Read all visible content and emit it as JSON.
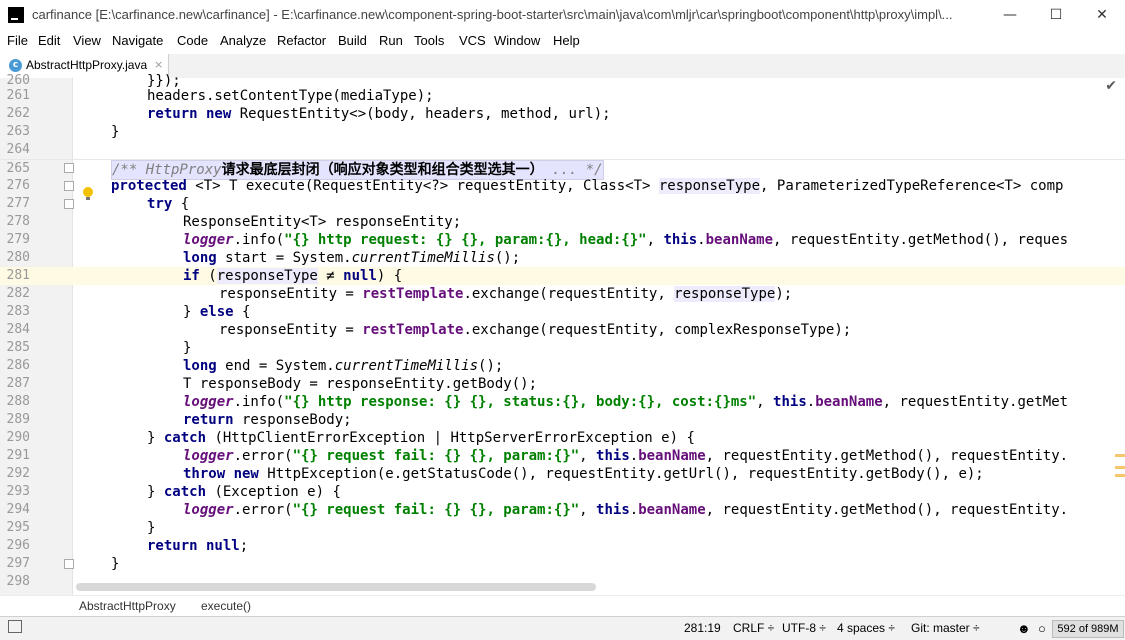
{
  "window": {
    "title": "carfinance [E:\\carfinance.new\\carfinance] - E:\\carfinance.new\\component-spring-boot-starter\\src\\main\\java\\com\\mljr\\car\\springboot\\component\\http\\proxy\\impl\\...",
    "minimize": "—",
    "maximize": "☐",
    "close": "✕"
  },
  "menu": [
    "File",
    "Edit",
    "View",
    "Navigate",
    "Code",
    "Analyze",
    "Refactor",
    "Build",
    "Run",
    "Tools",
    "VCS",
    "Window",
    "Help"
  ],
  "tab": {
    "icon": "c",
    "label": "AbstractHttpProxy.java",
    "close": "×"
  },
  "lines": [
    "260",
    "261",
    "262",
    "263",
    "264",
    "265",
    "276",
    "277",
    "278",
    "279",
    "280",
    "281",
    "282",
    "283",
    "284",
    "285",
    "286",
    "287",
    "288",
    "289",
    "290",
    "291",
    "292",
    "293",
    "294",
    "295",
    "296",
    "297",
    "298"
  ],
  "code": {
    "l260": "}});",
    "l261a": "headers.setContentType(mediaType);",
    "l262a": "return new",
    "l262b": " RequestEntity<>(body, headers, method, url);",
    "l263": "}",
    "l265a": "/** HttpProxy",
    "l265b": "请求最底层封闭（响应对象类型和组合类型选其一）",
    "l265c": " ... */",
    "l276a": "protected",
    "l276b": " <T> T execute(RequestEntity<?> requestEntity, Class<T> ",
    "l276c": "responseType",
    "l276d": ", ParameterizedTypeReference<T> comp",
    "l277a": "try",
    "l277b": " {",
    "l278": "ResponseEntity<T> responseEntity;",
    "l279a": "logger",
    "l279b": ".info(",
    "l279c": "\"{} http request: {} {}, param:{}, head:{}\"",
    "l279d": ", ",
    "l279e": "this",
    "l279f": ".",
    "l279g": "beanName",
    "l279h": ", requestEntity.getMethod(), reques",
    "l280a": "long",
    "l280b": " start = System.",
    "l280c": "currentTimeMillis",
    "l280d": "();",
    "l281a": "if",
    "l281b": " (",
    "l281c": "responseType",
    "l281d": " ≠ ",
    "l281e": "null",
    "l281f": ") {",
    "l282a": "responseEntity = ",
    "l282b": "restTemplate",
    "l282c": ".exchange(requestEntity, ",
    "l282d": "responseType",
    "l282e": ");",
    "l283a": "} ",
    "l283b": "else",
    "l283c": " {",
    "l284a": "responseEntity = ",
    "l284b": "restTemplate",
    "l284c": ".exchange(requestEntity, complexResponseType);",
    "l285": "}",
    "l286a": "long",
    "l286b": " end = System.",
    "l286c": "currentTimeMillis",
    "l286d": "();",
    "l287": "T responseBody = responseEntity.getBody();",
    "l288a": "logger",
    "l288b": ".info(",
    "l288c": "\"{} http response: {} {}, status:{}, body:{}, cost:{}ms\"",
    "l288d": ", ",
    "l288e": "this",
    "l288f": ".",
    "l288g": "beanName",
    "l288h": ", requestEntity.getMet",
    "l289a": "return",
    "l289b": " responseBody;",
    "l290a": "} ",
    "l290b": "catch",
    "l290c": " (HttpClientErrorException | HttpServerErrorException e) {",
    "l291a": "logger",
    "l291b": ".error(",
    "l291c": "\"{} request fail: {} {}, param:{}\"",
    "l291d": ", ",
    "l291e": "this",
    "l291f": ".",
    "l291g": "beanName",
    "l291h": ", requestEntity.getMethod(), requestEntity.",
    "l292a": "throw new",
    "l292b": " HttpException(e.getStatusCode(), requestEntity.getUrl(), requestEntity.getBody(), e);",
    "l293a": "} ",
    "l293b": "catch",
    "l293c": " (Exception e) {",
    "l294a": "logger",
    "l294b": ".error(",
    "l294c": "\"{} request fail: {} {}, param:{}\"",
    "l294d": ", ",
    "l294e": "this",
    "l294f": ".",
    "l294g": "beanName",
    "l294h": ", requestEntity.getMethod(), requestEntity.",
    "l295": "}",
    "l296a": "return null",
    "l296b": ";",
    "l297": "}"
  },
  "breadcrumbs": [
    "AbstractHttpProxy",
    "execute()"
  ],
  "status": {
    "position": "281:19",
    "line_separator": "CRLF ÷",
    "encoding": "UTF-8 ÷",
    "indent": "4 spaces ÷",
    "vcs": "Git: master ÷",
    "memory": "592 of 989M"
  },
  "colors": {
    "keyword": "#000080",
    "string": "#008000",
    "field": "#660e7a",
    "comment": "#808080",
    "current_line": "#fffae3"
  }
}
